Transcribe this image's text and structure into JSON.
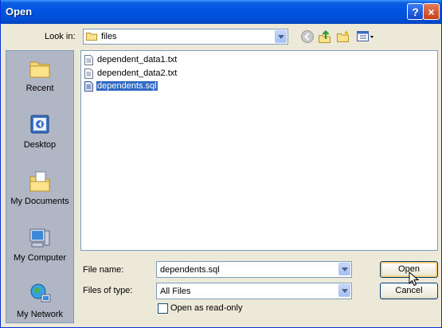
{
  "window": {
    "title": "Open"
  },
  "titlebar": {
    "help": "?",
    "close": "×"
  },
  "lookin": {
    "label": "Look in:",
    "value": "files"
  },
  "toolbar": {
    "icons": [
      "back-icon",
      "up-folder-icon",
      "new-folder-icon",
      "view-menu-icon"
    ]
  },
  "places": [
    {
      "label": "Recent",
      "icon": "recent-folder-icon"
    },
    {
      "label": "Desktop",
      "icon": "desktop-icon"
    },
    {
      "label": "My Documents",
      "icon": "my-documents-icon"
    },
    {
      "label": "My Computer",
      "icon": "my-computer-icon"
    },
    {
      "label": "My Network",
      "icon": "my-network-icon"
    }
  ],
  "files": [
    {
      "name": "dependent_data1.txt",
      "icon": "text-file-icon",
      "selected": false
    },
    {
      "name": "dependent_data2.txt",
      "icon": "text-file-icon",
      "selected": false
    },
    {
      "name": "dependents.sql",
      "icon": "sql-file-icon",
      "selected": true
    }
  ],
  "filename": {
    "label": "File name:",
    "value": "dependents.sql"
  },
  "filetype": {
    "label": "Files of type:",
    "value": "All Files"
  },
  "readonly": {
    "label": "Open as read-only",
    "checked": false
  },
  "buttons": {
    "open": "Open",
    "cancel": "Cancel"
  },
  "colors": {
    "title_bar": "#0054e3",
    "dialog_bg": "#ece9d8",
    "selection": "#316ac5",
    "places_bar": "#b0b6c3"
  }
}
